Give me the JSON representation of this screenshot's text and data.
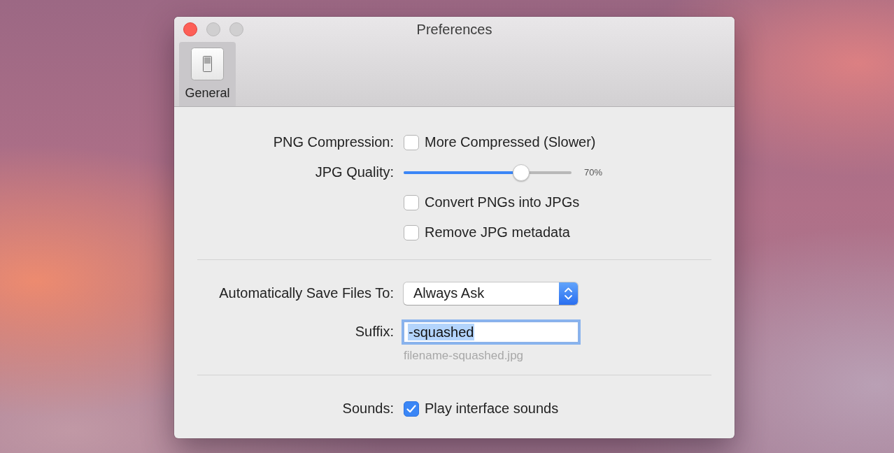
{
  "window": {
    "title": "Preferences",
    "buttons": [
      {
        "kind": "close",
        "disabled": false
      },
      {
        "kind": "minimize",
        "disabled": true
      },
      {
        "kind": "zoom",
        "disabled": true
      }
    ]
  },
  "toolbar": {
    "tabs": [
      {
        "label": "General",
        "selected": true
      }
    ]
  },
  "sections": [
    {
      "rows": [
        {
          "kind": "checkbox",
          "label": "PNG Compression:",
          "text": "More Compressed (Slower)",
          "checked": false
        },
        {
          "kind": "slider",
          "label": "JPG Quality:",
          "level": 0.7,
          "reading": "70%"
        },
        {
          "kind": "checkbox",
          "text": "Convert PNGs into JPGs",
          "checked": false
        },
        {
          "kind": "checkbox",
          "text": "Remove JPG metadata",
          "checked": false
        }
      ]
    },
    {
      "rows": [
        {
          "kind": "popup",
          "label": "Automatically Save Files To:",
          "value": "Always Ask"
        },
        {
          "kind": "text_field",
          "label": "Suffix:",
          "value": "-squashed",
          "focused": true,
          "value_selected": true,
          "hint": "filename-squashed.jpg"
        }
      ]
    },
    {
      "rows": [
        {
          "kind": "checkbox",
          "label": "Sounds:",
          "text": "Play interface sounds",
          "checked": true
        }
      ]
    }
  ]
}
